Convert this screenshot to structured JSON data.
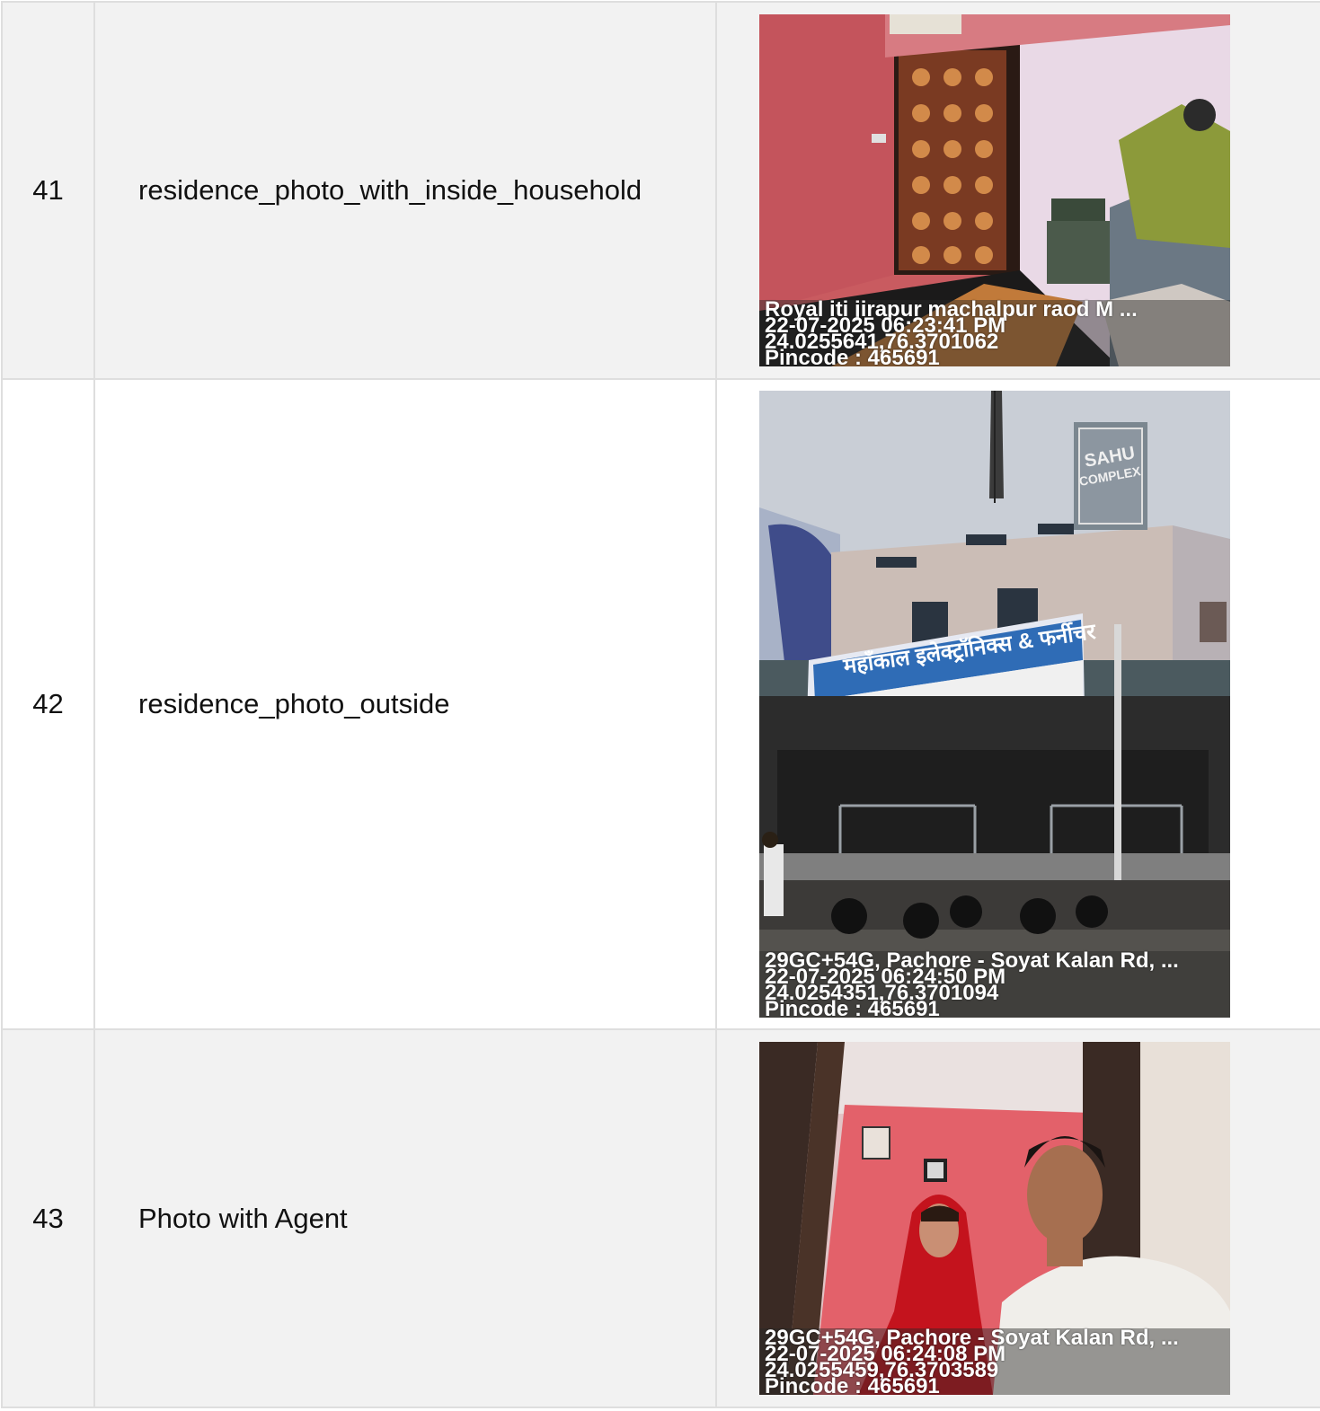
{
  "rows": [
    {
      "index": "41",
      "label": "residence_photo_with_inside_household",
      "stamp": {
        "location": "Royal iti jirapur machalpur raod M ...",
        "datetime": "22-07-2025 06:23:41 PM",
        "coords": "24.0255641,76.3701062",
        "pincode": "Pincode : 465691"
      }
    },
    {
      "index": "42",
      "label": "residence_photo_outside",
      "photo_text": {
        "building_sign": "SAHU",
        "building_sign2": "COMPLEX",
        "banner": "महाँकाल इलेक्ट्रॉनिक्स & फर्नीचर"
      },
      "stamp": {
        "location": "29GC+54G, Pachore - Soyat Kalan Rd, ...",
        "datetime": "22-07-2025 06:24:50 PM",
        "coords": "24.0254351,76.3701094",
        "pincode": "Pincode : 465691"
      }
    },
    {
      "index": "43",
      "label": "Photo with Agent",
      "stamp": {
        "location": "29GC+54G, Pachore - Soyat Kalan Rd, ...",
        "datetime": "22-07-2025 06:24:08 PM",
        "coords": "24.0255459,76.3703589",
        "pincode": "Pincode : 465691"
      }
    }
  ],
  "colors": {
    "row_alt_bg": "#f2f2f2",
    "border": "#dedede",
    "stamp_text": "#ffffff"
  }
}
